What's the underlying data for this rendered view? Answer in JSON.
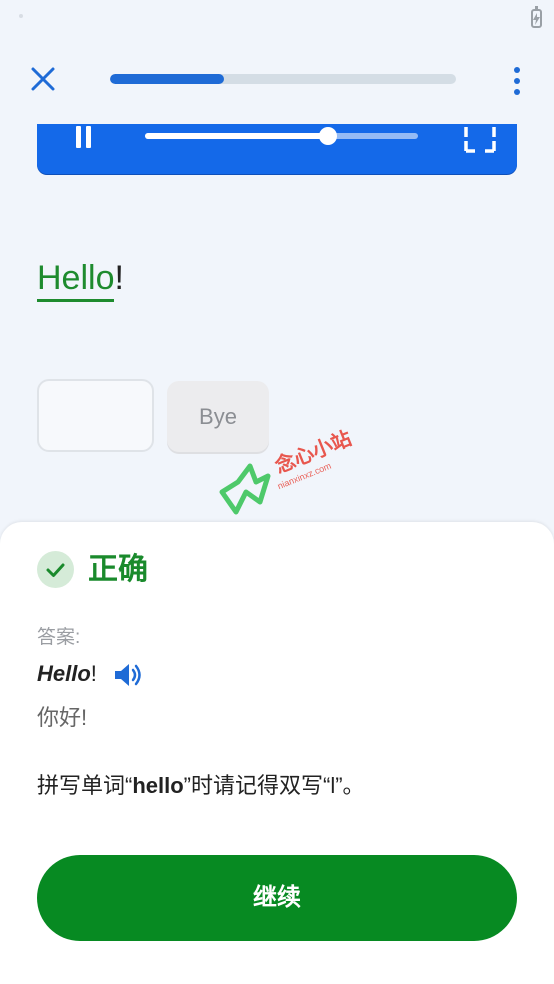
{
  "status_bar": {
    "battery_icon": "charging-battery-icon"
  },
  "top_bar": {
    "close_icon": "close-icon",
    "progress": 0.33,
    "more_icon": "more-vertical-icon"
  },
  "video_player": {
    "pause_icon": "pause-icon",
    "seek_position": 0.67,
    "fullscreen_icon": "fullscreen-icon"
  },
  "sentence": {
    "word": "Hello",
    "punctuation": "!"
  },
  "word_bank": {
    "option": "Bye"
  },
  "watermark": {
    "text": "念心小站",
    "subtext": "nianxinxz.com"
  },
  "feedback": {
    "status_icon": "check-icon",
    "status": "正确",
    "answer_caption": "答案:",
    "answer_word": "Hello",
    "answer_punct": "!",
    "speaker_icon": "speaker-icon",
    "translation": "你好!",
    "tip_prefix": "拼写单词“",
    "tip_word": "hello",
    "tip_suffix": "”时请记得双写“l”。",
    "continue_label": "继续"
  },
  "colors": {
    "accent_blue": "#1469e9",
    "success_green": "#078a22"
  }
}
